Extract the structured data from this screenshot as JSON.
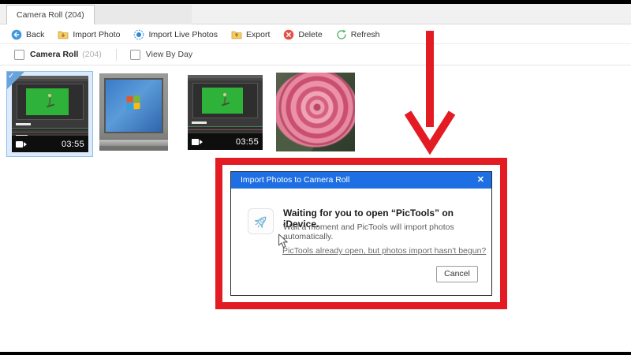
{
  "window": {
    "tab_label": "Camera Roll (204)"
  },
  "toolbar": {
    "items": [
      {
        "icon": "back-icon",
        "label": "Back"
      },
      {
        "icon": "import-photo-icon",
        "label": "Import Photo"
      },
      {
        "icon": "import-live-photos-icon",
        "label": "Import Live Photos"
      },
      {
        "icon": "export-icon",
        "label": "Export"
      },
      {
        "icon": "delete-icon",
        "label": "Delete"
      },
      {
        "icon": "refresh-icon",
        "label": "Refresh"
      }
    ]
  },
  "filter_bar": {
    "album_label": "Camera Roll",
    "album_count": "(204)",
    "view_by_day_label": "View By Day"
  },
  "thumbnails": [
    {
      "type": "video",
      "selected": true,
      "duration": "03:55",
      "check_glyph": "✓",
      "desc": "green-screen video open in editor"
    },
    {
      "type": "photo",
      "selected": false,
      "desc": "laptop showing Windows desktop"
    },
    {
      "type": "video",
      "selected": false,
      "duration": "03:55",
      "desc": "green-screen video open in editor"
    },
    {
      "type": "photo",
      "selected": false,
      "desc": "pink rose"
    }
  ],
  "dialog": {
    "title": "Import Photos to Camera Roll",
    "close_glyph": "✕",
    "heading": "Waiting for you to open “PicTools” on iDevice.",
    "subtext": "Wait a moment and PicTools will import photos automatically.",
    "link": "PicTools already open, but photos import hasn't begun?",
    "cancel_label": "Cancel"
  },
  "annotation": {
    "highlight_color": "#e31b23",
    "shape": "red box around dialog with red arrow pointing down at it"
  },
  "colors": {
    "dialog_titlebar": "#1e6fe3",
    "selection_border": "#90bee9",
    "green_screen": "#2fb23a",
    "annotation_red": "#e31b23"
  }
}
